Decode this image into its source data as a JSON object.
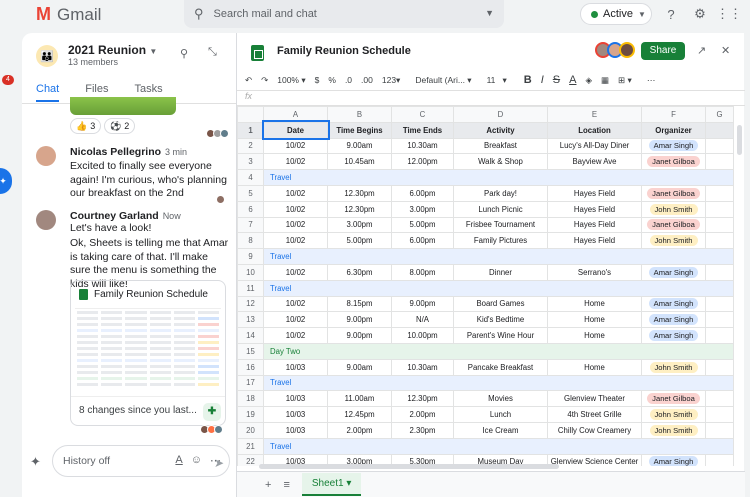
{
  "gmail": {
    "app_name": "Gmail",
    "search_placeholder": "Search mail and chat",
    "status": "Active",
    "rail_badge": "4"
  },
  "chat": {
    "room_title": "2021 Reunion",
    "room_members": "13 members",
    "tabs": [
      "Chat",
      "Files",
      "Tasks"
    ],
    "reactions": [
      {
        "emoji": "👍",
        "count": "3"
      },
      {
        "emoji": "⚽",
        "count": "2"
      }
    ],
    "messages": [
      {
        "name": "Nicolas Pellegrino",
        "time": "3 min",
        "text": "Excited to finally see everyone again! I'm curious, who's planning our breakfast on the 2nd"
      },
      {
        "name": "Courtney Garland",
        "time": "Now",
        "text": "Let's have a look!"
      },
      {
        "name": "",
        "time": "",
        "text": "Ok, Sheets is telling me that Amar is taking care of that. I'll make sure the menu is something the kids will like!"
      }
    ],
    "file_card": {
      "title": "Family Reunion Schedule",
      "footer": "8 changes since you last..."
    },
    "composer_placeholder": "History off"
  },
  "sheet": {
    "title": "Family Reunion Schedule",
    "share_label": "Share",
    "toolbar": {
      "zoom": "100%",
      "currency": "$",
      "percent": "%",
      "dec_minus": ".0",
      "dec_plus": ".00",
      "format": "123",
      "font": "Default (Ari...",
      "font_size": "11",
      "bold": "B",
      "italic": "I",
      "strike": "S",
      "text_color": "A"
    },
    "fx": "fx",
    "columns": [
      "A",
      "B",
      "C",
      "D",
      "E",
      "F",
      "G"
    ],
    "rows": [
      {
        "n": "1",
        "type": "header",
        "cells": [
          "Date",
          "Time Begins",
          "Time Ends",
          "Activity",
          "Location",
          "Organizer"
        ]
      },
      {
        "n": "2",
        "type": "row",
        "cells": [
          "10/02",
          "9.00am",
          "10.30am",
          "Breakfast",
          "Lucy's All-Day Diner",
          "Amar Singh"
        ]
      },
      {
        "n": "3",
        "type": "row",
        "cells": [
          "10/02",
          "10.45am",
          "12.00pm",
          "Walk & Shop",
          "Bayview Ave",
          "Janet Gilboa"
        ]
      },
      {
        "n": "4",
        "type": "band",
        "cells": [
          "Travel"
        ]
      },
      {
        "n": "5",
        "type": "row",
        "cells": [
          "10/02",
          "12.30pm",
          "6.00pm",
          "Park day!",
          "Hayes Field",
          "Janet Gilboa"
        ]
      },
      {
        "n": "6",
        "type": "row",
        "cells": [
          "10/02",
          "12.30pm",
          "3.00pm",
          "Lunch Picnic",
          "Hayes Field",
          "John Smith"
        ]
      },
      {
        "n": "7",
        "type": "row",
        "cells": [
          "10/02",
          "3.00pm",
          "5.00pm",
          "Frisbee Tournament",
          "Hayes Field",
          "Janet Gilboa"
        ]
      },
      {
        "n": "8",
        "type": "row",
        "cells": [
          "10/02",
          "5.00pm",
          "6.00pm",
          "Family Pictures",
          "Hayes Field",
          "John Smith"
        ]
      },
      {
        "n": "9",
        "type": "band",
        "cells": [
          "Travel"
        ]
      },
      {
        "n": "10",
        "type": "row",
        "cells": [
          "10/02",
          "6.30pm",
          "8.00pm",
          "Dinner",
          "Serrano's",
          "Amar Singh"
        ]
      },
      {
        "n": "11",
        "type": "band",
        "cells": [
          "Travel"
        ]
      },
      {
        "n": "12",
        "type": "row",
        "cells": [
          "10/02",
          "8.15pm",
          "9.00pm",
          "Board Games",
          "Home",
          "Amar Singh"
        ]
      },
      {
        "n": "13",
        "type": "row",
        "cells": [
          "10/02",
          "9.00pm",
          "N/A",
          "Kid's Bedtime",
          "Home",
          "Amar Singh"
        ]
      },
      {
        "n": "14",
        "type": "row",
        "cells": [
          "10/02",
          "9.00pm",
          "10.00pm",
          "Parent's Wine Hour",
          "Home",
          "Amar Singh"
        ]
      },
      {
        "n": "15",
        "type": "band-green",
        "cells": [
          "Day Two"
        ]
      },
      {
        "n": "16",
        "type": "row",
        "cells": [
          "10/03",
          "9.00am",
          "10.30am",
          "Pancake Breakfast",
          "Home",
          "John Smith"
        ]
      },
      {
        "n": "17",
        "type": "band",
        "cells": [
          "Travel"
        ]
      },
      {
        "n": "18",
        "type": "row",
        "cells": [
          "10/03",
          "11.00am",
          "12.30pm",
          "Movies",
          "Glenview Theater",
          "Janet Gilboa"
        ]
      },
      {
        "n": "19",
        "type": "row",
        "cells": [
          "10/03",
          "12.45pm",
          "2.00pm",
          "Lunch",
          "4th Street Grille",
          "John Smith"
        ]
      },
      {
        "n": "20",
        "type": "row",
        "cells": [
          "10/03",
          "2.00pm",
          "2.30pm",
          "Ice Cream",
          "Chilly Cow Creamery",
          "John Smith"
        ]
      },
      {
        "n": "21",
        "type": "band",
        "cells": [
          "Travel"
        ]
      },
      {
        "n": "22",
        "type": "row",
        "cells": [
          "10/03",
          "3.00pm",
          "5.30pm",
          "Museum Day",
          "Glenview Science Center",
          "Amar Singh"
        ]
      }
    ],
    "chip_colors": {
      "Amar Singh": "#d2e3fc",
      "Janet Gilboa": "#fad2cf",
      "John Smith": "#feefc3"
    },
    "sheet_tab": "Sheet1"
  }
}
